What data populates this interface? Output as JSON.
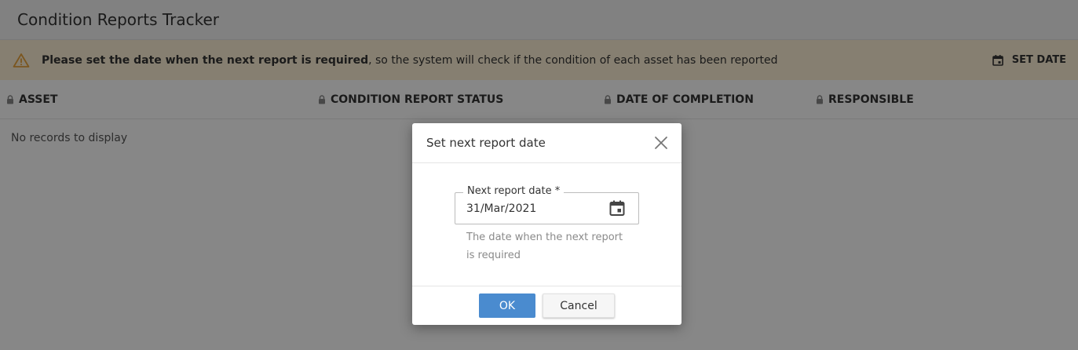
{
  "header": {
    "title": "Condition Reports Tracker"
  },
  "banner": {
    "message_bold": "Please set the date when the next report is required",
    "message_rest": ", so the system will check if the condition of each asset has been reported",
    "action_label": "SET DATE",
    "icon": "warning-icon",
    "accent_color": "#e8a33c"
  },
  "grid": {
    "columns": [
      "ASSET",
      "CONDITION REPORT STATUS",
      "DATE OF COMPLETION",
      "RESPONSIBLE"
    ],
    "empty_text": "No records to display"
  },
  "dialog": {
    "title": "Set next report date",
    "field_label": "Next report date *",
    "field_value": "31/Mar/2021",
    "hint": "The date when the next report is required",
    "ok_label": "OK",
    "cancel_label": "Cancel",
    "ok_color": "#4a8bcf"
  }
}
